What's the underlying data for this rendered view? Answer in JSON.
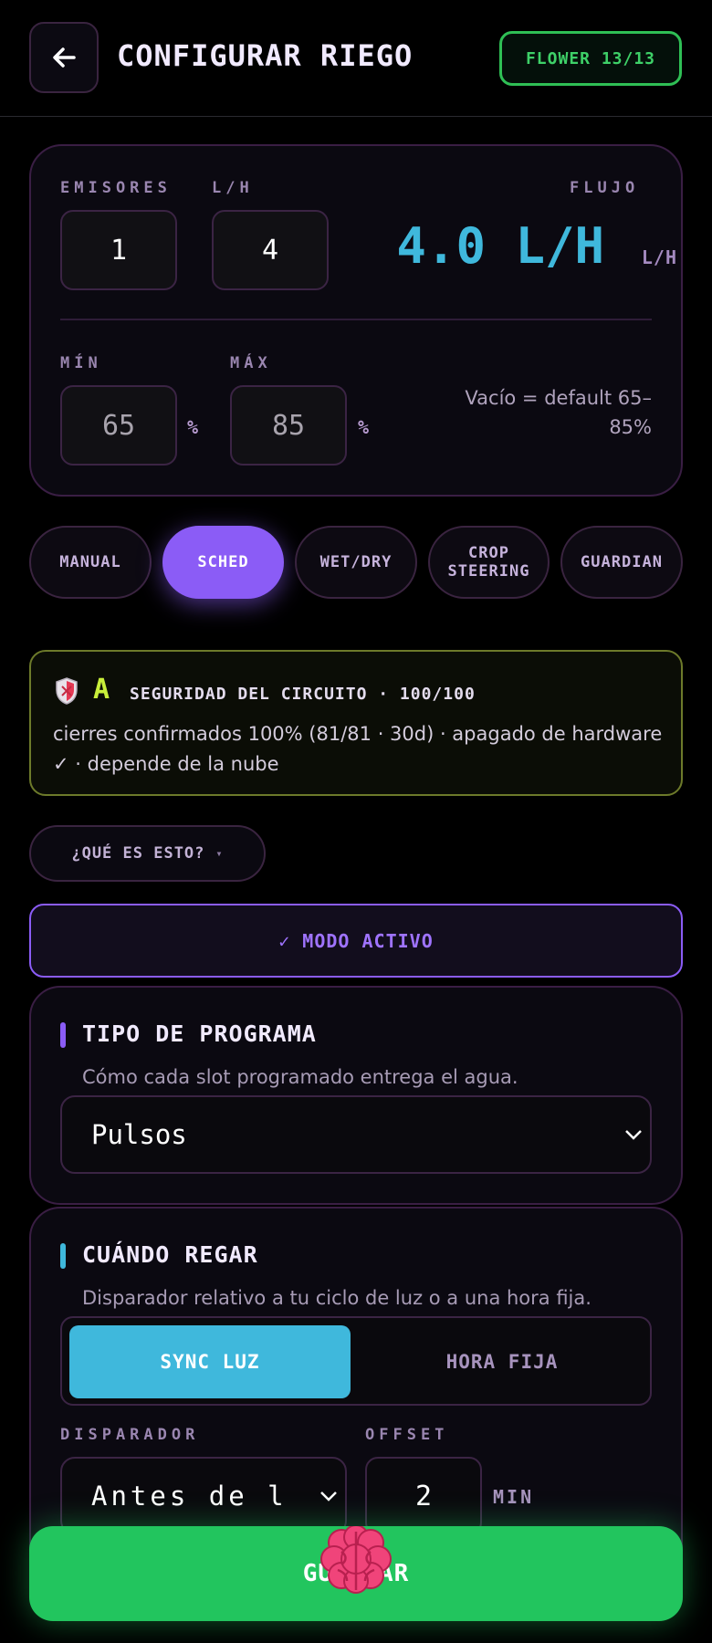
{
  "header": {
    "title": "CONFIGURAR RIEGO",
    "badge": "FLOWER 13/13",
    "back_icon": "arrow-left-icon"
  },
  "emitters": {
    "emitters_label": "EMISORES",
    "emitters_value": "1",
    "lh_label": "L/H",
    "lh_value": "4",
    "flow_label": "FLUJO",
    "flow_value": "4.0 L/H",
    "flow_unit": "L/H"
  },
  "range": {
    "min_label": "MÍN",
    "min_placeholder": "65",
    "min_unit": "%",
    "max_label": "MÁX",
    "max_placeholder": "85",
    "max_unit": "%",
    "hint": "Vacío = default 65–85%"
  },
  "modes": {
    "active": "SCHED",
    "items": [
      {
        "label": "MANUAL"
      },
      {
        "label": "SCHED"
      },
      {
        "label": "WET/DRY"
      },
      {
        "label": "CROP STEERING"
      },
      {
        "label": "GUARDIAN"
      }
    ]
  },
  "security": {
    "icon": "shield-icon",
    "grade": "A",
    "title": "SEGURIDAD DEL CIRCUITO · 100/100",
    "body": "cierres confirmados 100% (81/81 · 30d) · apagado de hardware ✓ · depende de la nube",
    "color": "#c8ee3a"
  },
  "what_is_this": {
    "label": "¿QUÉ ES ESTO?",
    "caret": "▾"
  },
  "active_mode": {
    "label": "✓ MODO ACTIVO"
  },
  "program_type": {
    "title": "TIPO DE PROGRAMA",
    "subtitle": "Cómo cada slot programado entrega el agua.",
    "selected": "Pulsos",
    "accent": "#8b5cf6"
  },
  "when": {
    "title": "CUÁNDO REGAR",
    "subtitle": "Disparador relativo a tu ciclo de luz o a una hora fija.",
    "accent": "#3fb8dc",
    "segments": [
      {
        "label": "SYNC LUZ",
        "active": true
      },
      {
        "label": "HORA FIJA",
        "active": false
      }
    ],
    "trigger_label": "DISPARADOR",
    "trigger_value": "Antes de l",
    "offset_label": "OFFSET",
    "offset_value": "2",
    "offset_unit": "MIN"
  },
  "save": {
    "label": "GUARDAR",
    "icon": "brain-icon"
  }
}
